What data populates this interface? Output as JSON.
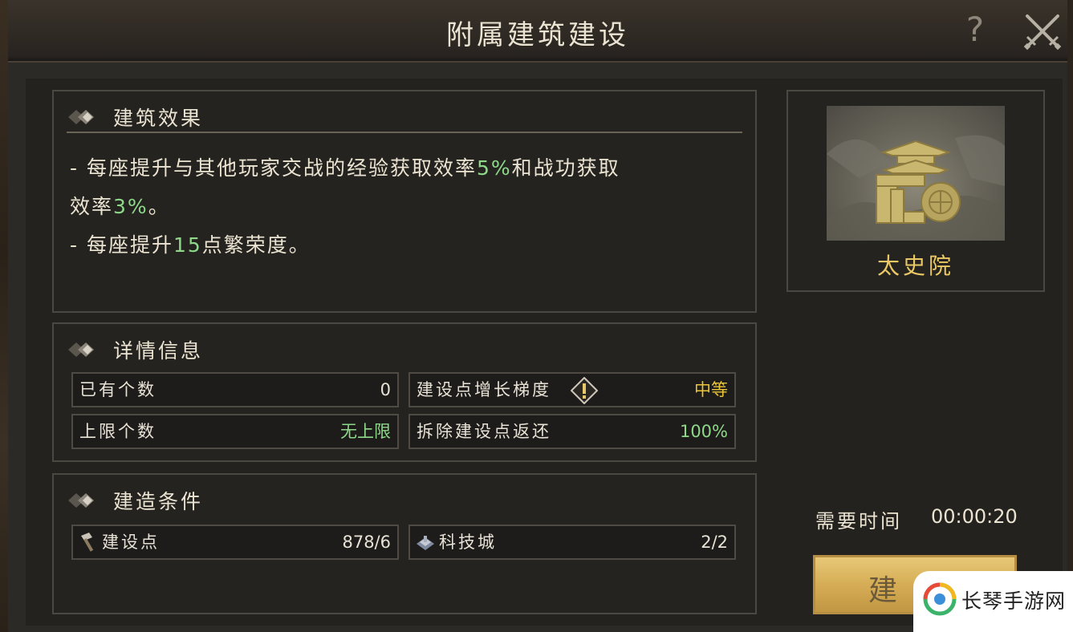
{
  "window": {
    "title": "附属建筑建设",
    "help_label": "?"
  },
  "effect_panel": {
    "heading": "建筑效果",
    "line1_a": "- 每座提升与其他玩家交战的经验获取效率",
    "line1_hl1": "5%",
    "line1_b": "和战功获取",
    "line2_a": "效率",
    "line2_hl": "3%",
    "line2_b": "。",
    "line3_a": "- 每座提升",
    "line3_hl": "15",
    "line3_b": "点繁荣度。"
  },
  "details_panel": {
    "heading": "详情信息",
    "rows": [
      {
        "key": "已有个数",
        "value": "0"
      },
      {
        "key": "建设点增长梯度",
        "value": "中等"
      },
      {
        "key": "上限个数",
        "value": "无上限"
      },
      {
        "key": "拆除建设点返还",
        "value": "100%"
      }
    ]
  },
  "conditions_panel": {
    "heading": "建造条件",
    "rows": [
      {
        "key": "建设点",
        "value": "878/6",
        "icon": "hammer-icon"
      },
      {
        "key": "科技城",
        "value": "2/2",
        "icon": "tech-city-icon"
      }
    ]
  },
  "building": {
    "name": "太史院"
  },
  "build_time": {
    "label": "需要时间",
    "value": "00:00:20"
  },
  "build_button": {
    "label": "建造"
  },
  "watermark": {
    "text": "长琴手游网"
  },
  "colors": {
    "highlight_green": "#8ed88a",
    "highlight_yellow": "#e9c436",
    "gold": "#e9c865",
    "button_gold": "#d6ad56"
  }
}
